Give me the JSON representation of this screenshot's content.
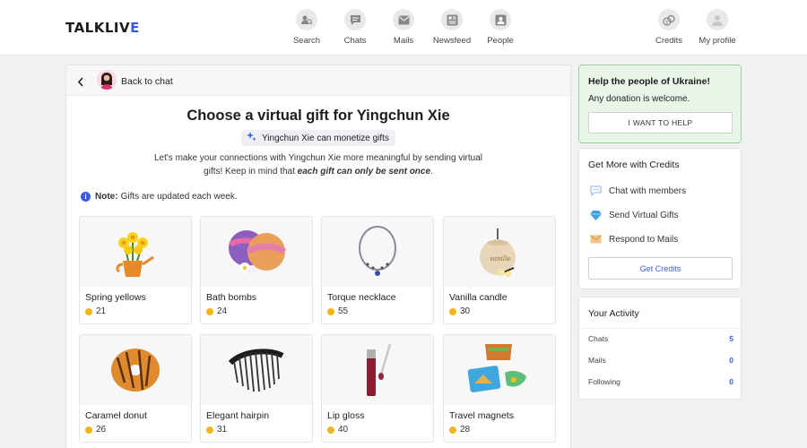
{
  "header": {
    "logo_main": "TALKLIV",
    "logo_accent": "E",
    "nav": [
      {
        "label": "Search",
        "icon": "search-people-icon"
      },
      {
        "label": "Chats",
        "icon": "chat-bubble-icon"
      },
      {
        "label": "Mails",
        "icon": "mail-icon"
      },
      {
        "label": "Newsfeed",
        "icon": "newsfeed-icon"
      },
      {
        "label": "People",
        "icon": "people-icon"
      }
    ],
    "right_nav": [
      {
        "label": "Credits",
        "icon": "credits-coins-icon"
      },
      {
        "label": "My profile",
        "icon": "profile-avatar-icon"
      }
    ]
  },
  "main": {
    "back_label": "Back to chat",
    "title": "Choose a virtual gift for Yingchun Xie",
    "monetize_badge": "Yingchun Xie can monetize gifts",
    "intro_plain": "Let's make your connections with Yingchun Xie more meaningful by sending virtual gifts! Keep in mind that ",
    "intro_emphasis": "each gift can only be sent once",
    "intro_end": ".",
    "note_label": "Note:",
    "note_text": "Gifts are updated each week.",
    "gifts": [
      {
        "name": "Spring yellows",
        "price": "21",
        "icon": "daffodils-watering-can-icon"
      },
      {
        "name": "Bath bombs",
        "price": "24",
        "icon": "bath-bombs-icon"
      },
      {
        "name": "Torque necklace",
        "price": "55",
        "icon": "necklace-icon"
      },
      {
        "name": "Vanilla candle",
        "price": "30",
        "icon": "candle-icon"
      },
      {
        "name": "Caramel donut",
        "price": "26",
        "icon": "donut-icon"
      },
      {
        "name": "Elegant hairpin",
        "price": "31",
        "icon": "hair-comb-icon"
      },
      {
        "name": "Lip gloss",
        "price": "40",
        "icon": "lip-gloss-icon"
      },
      {
        "name": "Travel magnets",
        "price": "28",
        "icon": "magnets-icon"
      }
    ]
  },
  "sidebar": {
    "ukraine": {
      "heading": "Help the people of Ukraine!",
      "subtext": "Any donation is welcome.",
      "button": "I WANT TO HELP"
    },
    "credits": {
      "heading": "Get More with Credits",
      "items": [
        {
          "label": "Chat with members",
          "icon": "chat-bubble-icon"
        },
        {
          "label": "Send Virtual Gifts",
          "icon": "diamond-icon"
        },
        {
          "label": "Respond to Mails",
          "icon": "envelope-icon"
        }
      ],
      "button": "Get Credits"
    },
    "activity": {
      "heading": "Your Activity",
      "rows": [
        {
          "label": "Chats",
          "value": "5"
        },
        {
          "label": "Mails",
          "value": "0"
        },
        {
          "label": "Following",
          "value": "0"
        }
      ]
    }
  },
  "colors": {
    "accent": "#3b5bd9",
    "coin": "#f1b51c",
    "ukraine_bg": "#eaf5ea"
  }
}
